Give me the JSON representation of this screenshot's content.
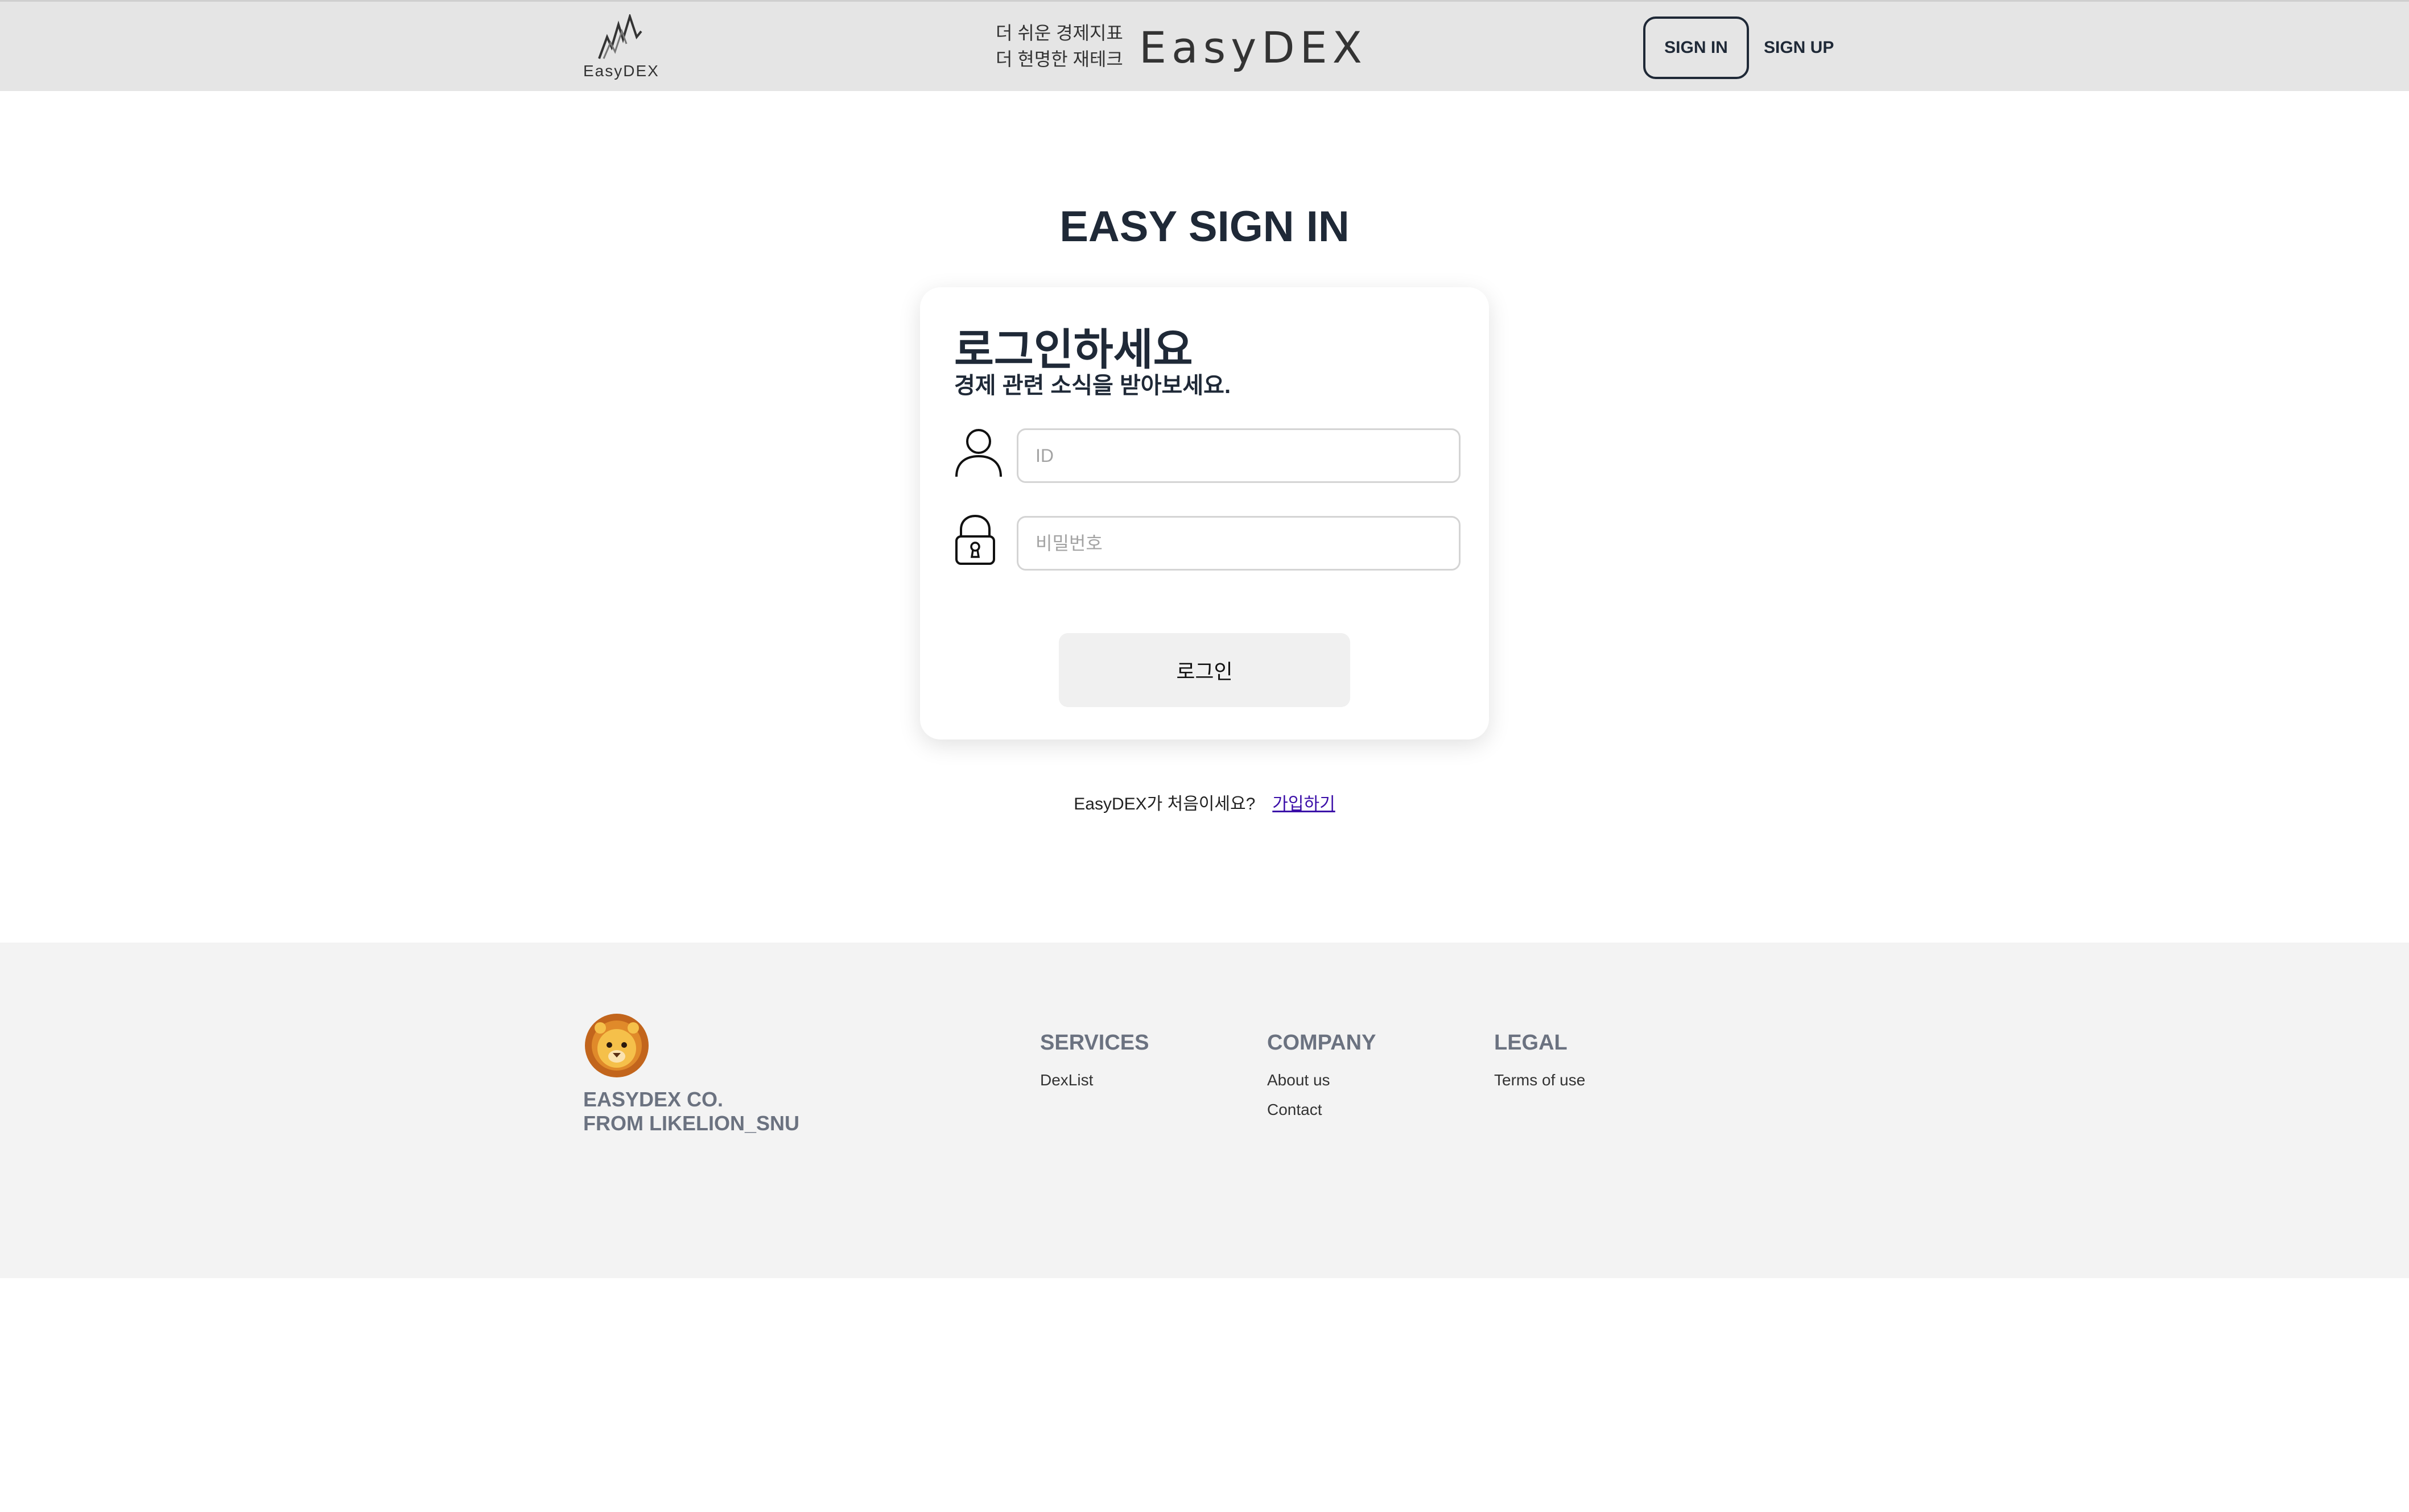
{
  "header": {
    "logo_text": "EasyDEX",
    "slogan_line1": "더 쉬운 경제지표",
    "slogan_line2": "더 현명한 재테크",
    "brand": "EasyDEX",
    "signin_label": "SIGN IN",
    "signup_label": "SIGN UP"
  },
  "main": {
    "title": "EASY SIGN IN",
    "card": {
      "heading": "로그인하세요",
      "subheading": "경제 관련 소식을 받아보세요.",
      "id_placeholder": "ID",
      "password_placeholder": "비밀번호",
      "login_label": "로그인"
    },
    "signup_prompt": "EasyDEX가 처음이세요?",
    "signup_link": "가입하기"
  },
  "footer": {
    "company_line1": "EASYDEX CO.",
    "company_line2": "FROM LIKELION_SNU",
    "columns": [
      {
        "heading": "SERVICES",
        "items": [
          "DexList"
        ]
      },
      {
        "heading": "COMPANY",
        "items": [
          "About us",
          "Contact"
        ]
      },
      {
        "heading": "LEGAL",
        "items": [
          "Terms of use"
        ]
      }
    ]
  },
  "colors": {
    "header_bg": "#e5e5e5",
    "footer_bg": "#f3f3f3",
    "text_dark": "#1f2937",
    "link": "#3b0ea8"
  },
  "icons": [
    "easydex-logo-icon",
    "user-icon",
    "lock-icon",
    "lion-icon"
  ]
}
